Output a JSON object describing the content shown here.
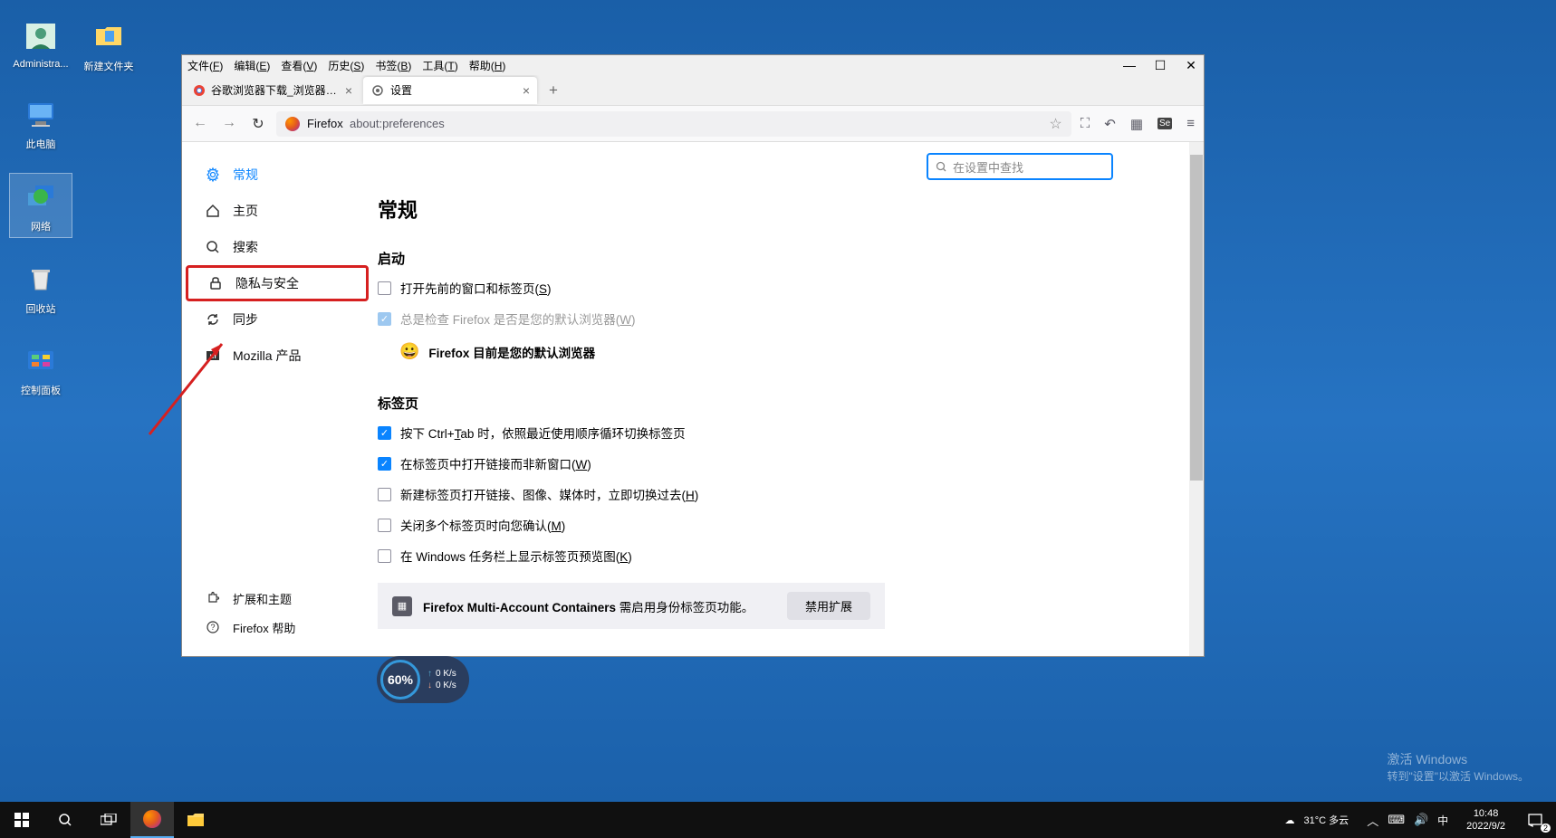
{
  "desktop": {
    "icons": [
      {
        "label": "Administra..."
      },
      {
        "label": "此电脑"
      },
      {
        "label": "网络"
      },
      {
        "label": "回收站"
      },
      {
        "label": "控制面板"
      }
    ],
    "folder": {
      "label": "新建文件夹"
    }
  },
  "window": {
    "menu": {
      "file": "文件(F)",
      "edit": "编辑(E)",
      "view": "查看(V)",
      "history": "历史(S)",
      "bookmarks": "书签(B)",
      "tools": "工具(T)",
      "help": "帮助(H)"
    },
    "tabs": [
      {
        "title": "谷歌浏览器下载_浏览器官网入口",
        "active": false
      },
      {
        "title": "设置",
        "active": true
      }
    ],
    "url_prefix": "Firefox",
    "url": "about:preferences"
  },
  "settings": {
    "search_placeholder": "在设置中查找",
    "sidebar": {
      "general": "常规",
      "home": "主页",
      "search": "搜索",
      "privacy": "隐私与安全",
      "sync": "同步",
      "mozilla": "Mozilla 产品"
    },
    "sidebar_footer": {
      "extensions": "扩展和主题",
      "help": "Firefox 帮助"
    },
    "page_title": "常规",
    "startup": {
      "heading": "启动",
      "restore": "打开先前的窗口和标签页(S)",
      "default_check": "总是检查 Firefox 是否是您的默认浏览器(W)",
      "default_status": "Firefox 目前是您的默认浏览器",
      "smile": "😀"
    },
    "tabs_section": {
      "heading": "标签页",
      "ctrl_tab": "按下 Ctrl+Tab 时，依照最近使用顺序循环切换标签页",
      "new_window": "在标签页中打开链接而非新窗口(W)",
      "switch_new": "新建标签页打开链接、图像、媒体时，立即切换过去(H)",
      "confirm_close": "关闭多个标签页时向您确认(M)",
      "taskbar_preview": "在 Windows 任务栏上显示标签页预览图(K)"
    },
    "extension_banner": {
      "text_strong": "Firefox Multi-Account Containers",
      "text_rest": " 需启用身份标签页功能。",
      "button": "禁用扩展"
    }
  },
  "speed_widget": {
    "percent": "60%",
    "up": "0 K/s",
    "down": "0 K/s"
  },
  "watermark": {
    "line1": "激活 Windows",
    "line2": "转到\"设置\"以激活 Windows。"
  },
  "taskbar": {
    "weather": "31°C 多云",
    "ime": "中",
    "time": "10:48",
    "date": "2022/9/2",
    "notif_count": "2"
  }
}
